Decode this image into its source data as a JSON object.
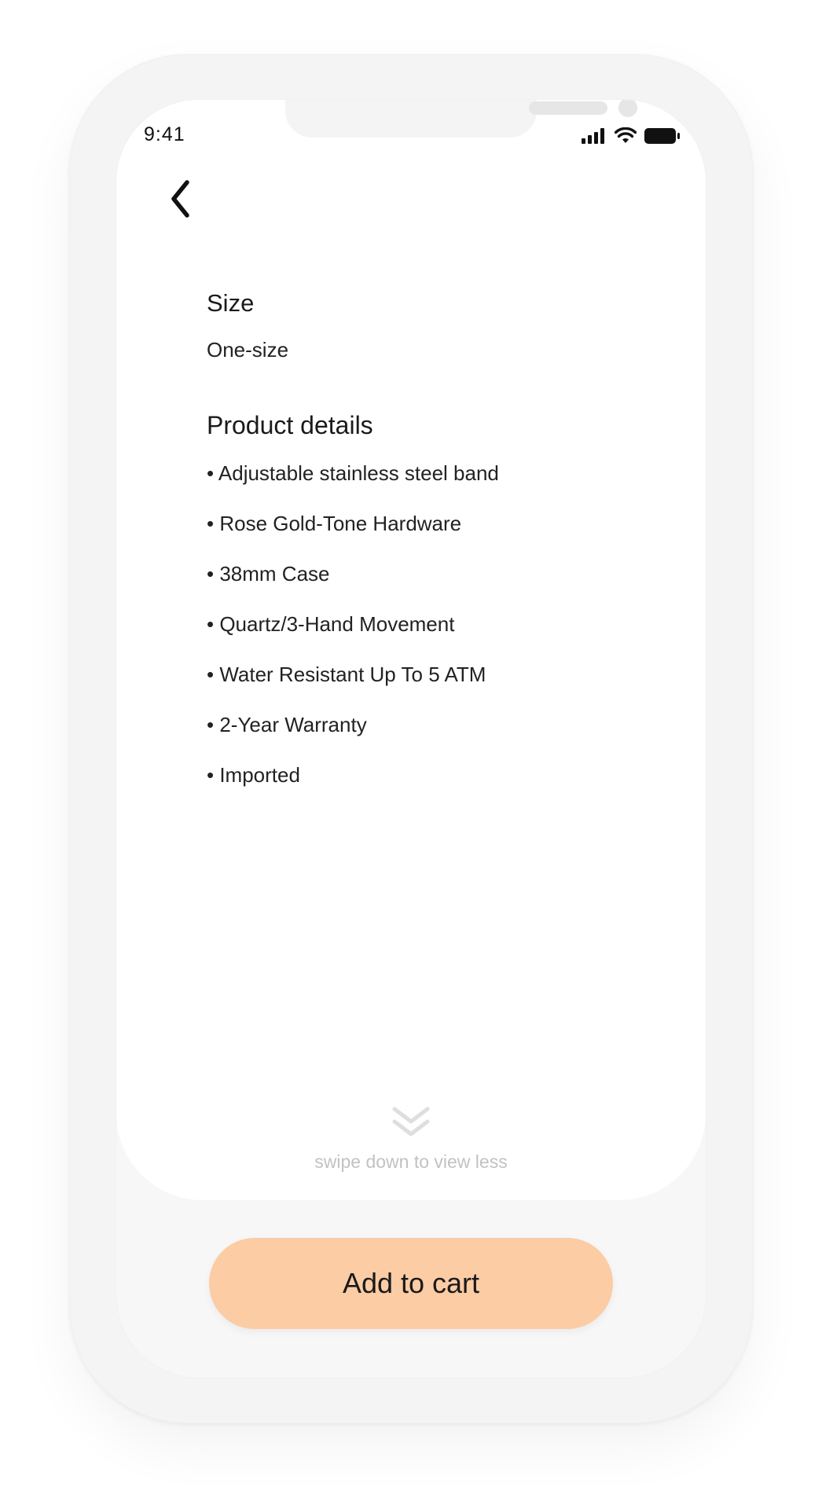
{
  "status_bar": {
    "time": "9:41",
    "icons": [
      "signal-icon",
      "wifi-icon",
      "battery-icon"
    ]
  },
  "nav": {
    "back_icon": "chevron-left-icon"
  },
  "size_section": {
    "heading": "Size",
    "value": "One-size"
  },
  "details_section": {
    "heading": "Product details",
    "items": [
      "• Adjustable stainless steel band",
      "• Rose Gold-Tone Hardware",
      "• 38mm Case",
      "• Quartz/3-Hand Movement",
      "• Water Resistant Up To 5 ATM",
      "• 2-Year Warranty",
      "• Imported"
    ]
  },
  "swipe_hint": {
    "icon": "double-chevron-down-icon",
    "text": "swipe down to view less"
  },
  "cart_button": {
    "label": "Add to cart"
  },
  "colors": {
    "accent": "#fccca4",
    "sheet": "#ffffff",
    "background": "#f7f7f7",
    "hint_text": "#c2c2c2"
  }
}
